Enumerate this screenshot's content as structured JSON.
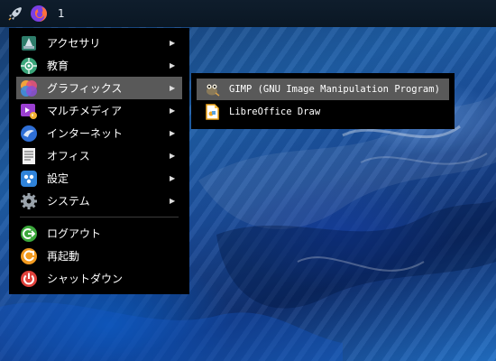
{
  "taskbar": {
    "launcher_icon": "rocket-icon",
    "browser_icon": "firefox-icon",
    "workspace_label": "1"
  },
  "menu": {
    "items": [
      {
        "label": "アクセサリ",
        "icon": "accessories-icon",
        "has_submenu": true
      },
      {
        "label": "教育",
        "icon": "education-icon",
        "has_submenu": true
      },
      {
        "label": "グラフィックス",
        "icon": "graphics-icon",
        "has_submenu": true,
        "active": true
      },
      {
        "label": "マルチメディア",
        "icon": "multimedia-icon",
        "has_submenu": true
      },
      {
        "label": "インターネット",
        "icon": "internet-icon",
        "has_submenu": true
      },
      {
        "label": "オフィス",
        "icon": "office-icon",
        "has_submenu": true
      },
      {
        "label": "設定",
        "icon": "settings-icon",
        "has_submenu": true
      },
      {
        "label": "システム",
        "icon": "system-icon",
        "has_submenu": true
      }
    ],
    "actions": [
      {
        "label": "ログアウト",
        "icon": "logout-icon"
      },
      {
        "label": "再起動",
        "icon": "reboot-icon"
      },
      {
        "label": "シャットダウン",
        "icon": "shutdown-icon"
      }
    ],
    "arrow_glyph": "▶"
  },
  "submenu": {
    "items": [
      {
        "label": "GIMP (GNU Image Manipulation Program)",
        "icon": "gimp-icon",
        "active": true
      },
      {
        "label": "LibreOffice Draw",
        "icon": "libreoffice-draw-icon"
      }
    ]
  },
  "colors": {
    "menu_bg": "#000000",
    "menu_highlight": "#595959",
    "taskbar_bg": "#0f1d2c"
  }
}
